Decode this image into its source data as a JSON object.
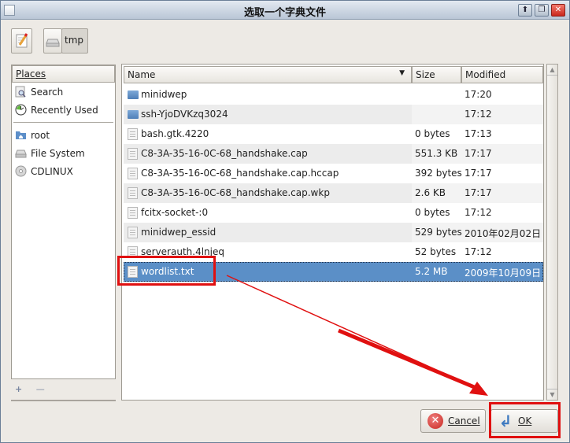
{
  "window": {
    "title": "选取一个字典文件",
    "controls": [
      "minimize",
      "maximize",
      "close"
    ]
  },
  "pathbar": {
    "edit_icon": "pencil-icon",
    "drive_icon": "drive-icon",
    "current": "tmp"
  },
  "places": {
    "header": "Places",
    "items": [
      {
        "label": "Search",
        "icon": "search-icon"
      },
      {
        "label": "Recently Used",
        "icon": "recent-icon"
      }
    ],
    "locations": [
      {
        "label": "root",
        "icon": "home-folder-icon"
      },
      {
        "label": "File System",
        "icon": "drive-icon"
      },
      {
        "label": "CDLINUX",
        "icon": "cdrom-icon"
      }
    ],
    "add_label": "+",
    "remove_label": "—"
  },
  "columns": {
    "name": "Name",
    "size": "Size",
    "modified": "Modified"
  },
  "files": [
    {
      "name": "minidwep",
      "size": "",
      "modified": "17:20",
      "type": "folder"
    },
    {
      "name": "ssh-YjoDVKzq3024",
      "size": "",
      "modified": "17:12",
      "type": "folder"
    },
    {
      "name": "bash.gtk.4220",
      "size": "0 bytes",
      "modified": "17:13",
      "type": "file"
    },
    {
      "name": "C8-3A-35-16-0C-68_handshake.cap",
      "size": "551.3 KB",
      "modified": "17:17",
      "type": "file"
    },
    {
      "name": "C8-3A-35-16-0C-68_handshake.cap.hccap",
      "size": "392 bytes",
      "modified": "17:17",
      "type": "file"
    },
    {
      "name": "C8-3A-35-16-0C-68_handshake.cap.wkp",
      "size": "2.6 KB",
      "modified": "17:17",
      "type": "file"
    },
    {
      "name": "fcitx-socket-:0",
      "size": "0 bytes",
      "modified": "17:12",
      "type": "file"
    },
    {
      "name": "minidwep_essid",
      "size": "529 bytes",
      "modified": "2010年02月02日",
      "type": "file"
    },
    {
      "name": "serverauth.4lnjeq",
      "size": "52 bytes",
      "modified": "17:12",
      "type": "file"
    },
    {
      "name": "wordlist.txt",
      "size": "5.2 MB",
      "modified": "2009年10月09日",
      "type": "file",
      "selected": true
    }
  ],
  "buttons": {
    "cancel": "Cancel",
    "ok": "OK"
  },
  "colors": {
    "selection": "#5b8fc7",
    "annotation": "#e01010"
  }
}
